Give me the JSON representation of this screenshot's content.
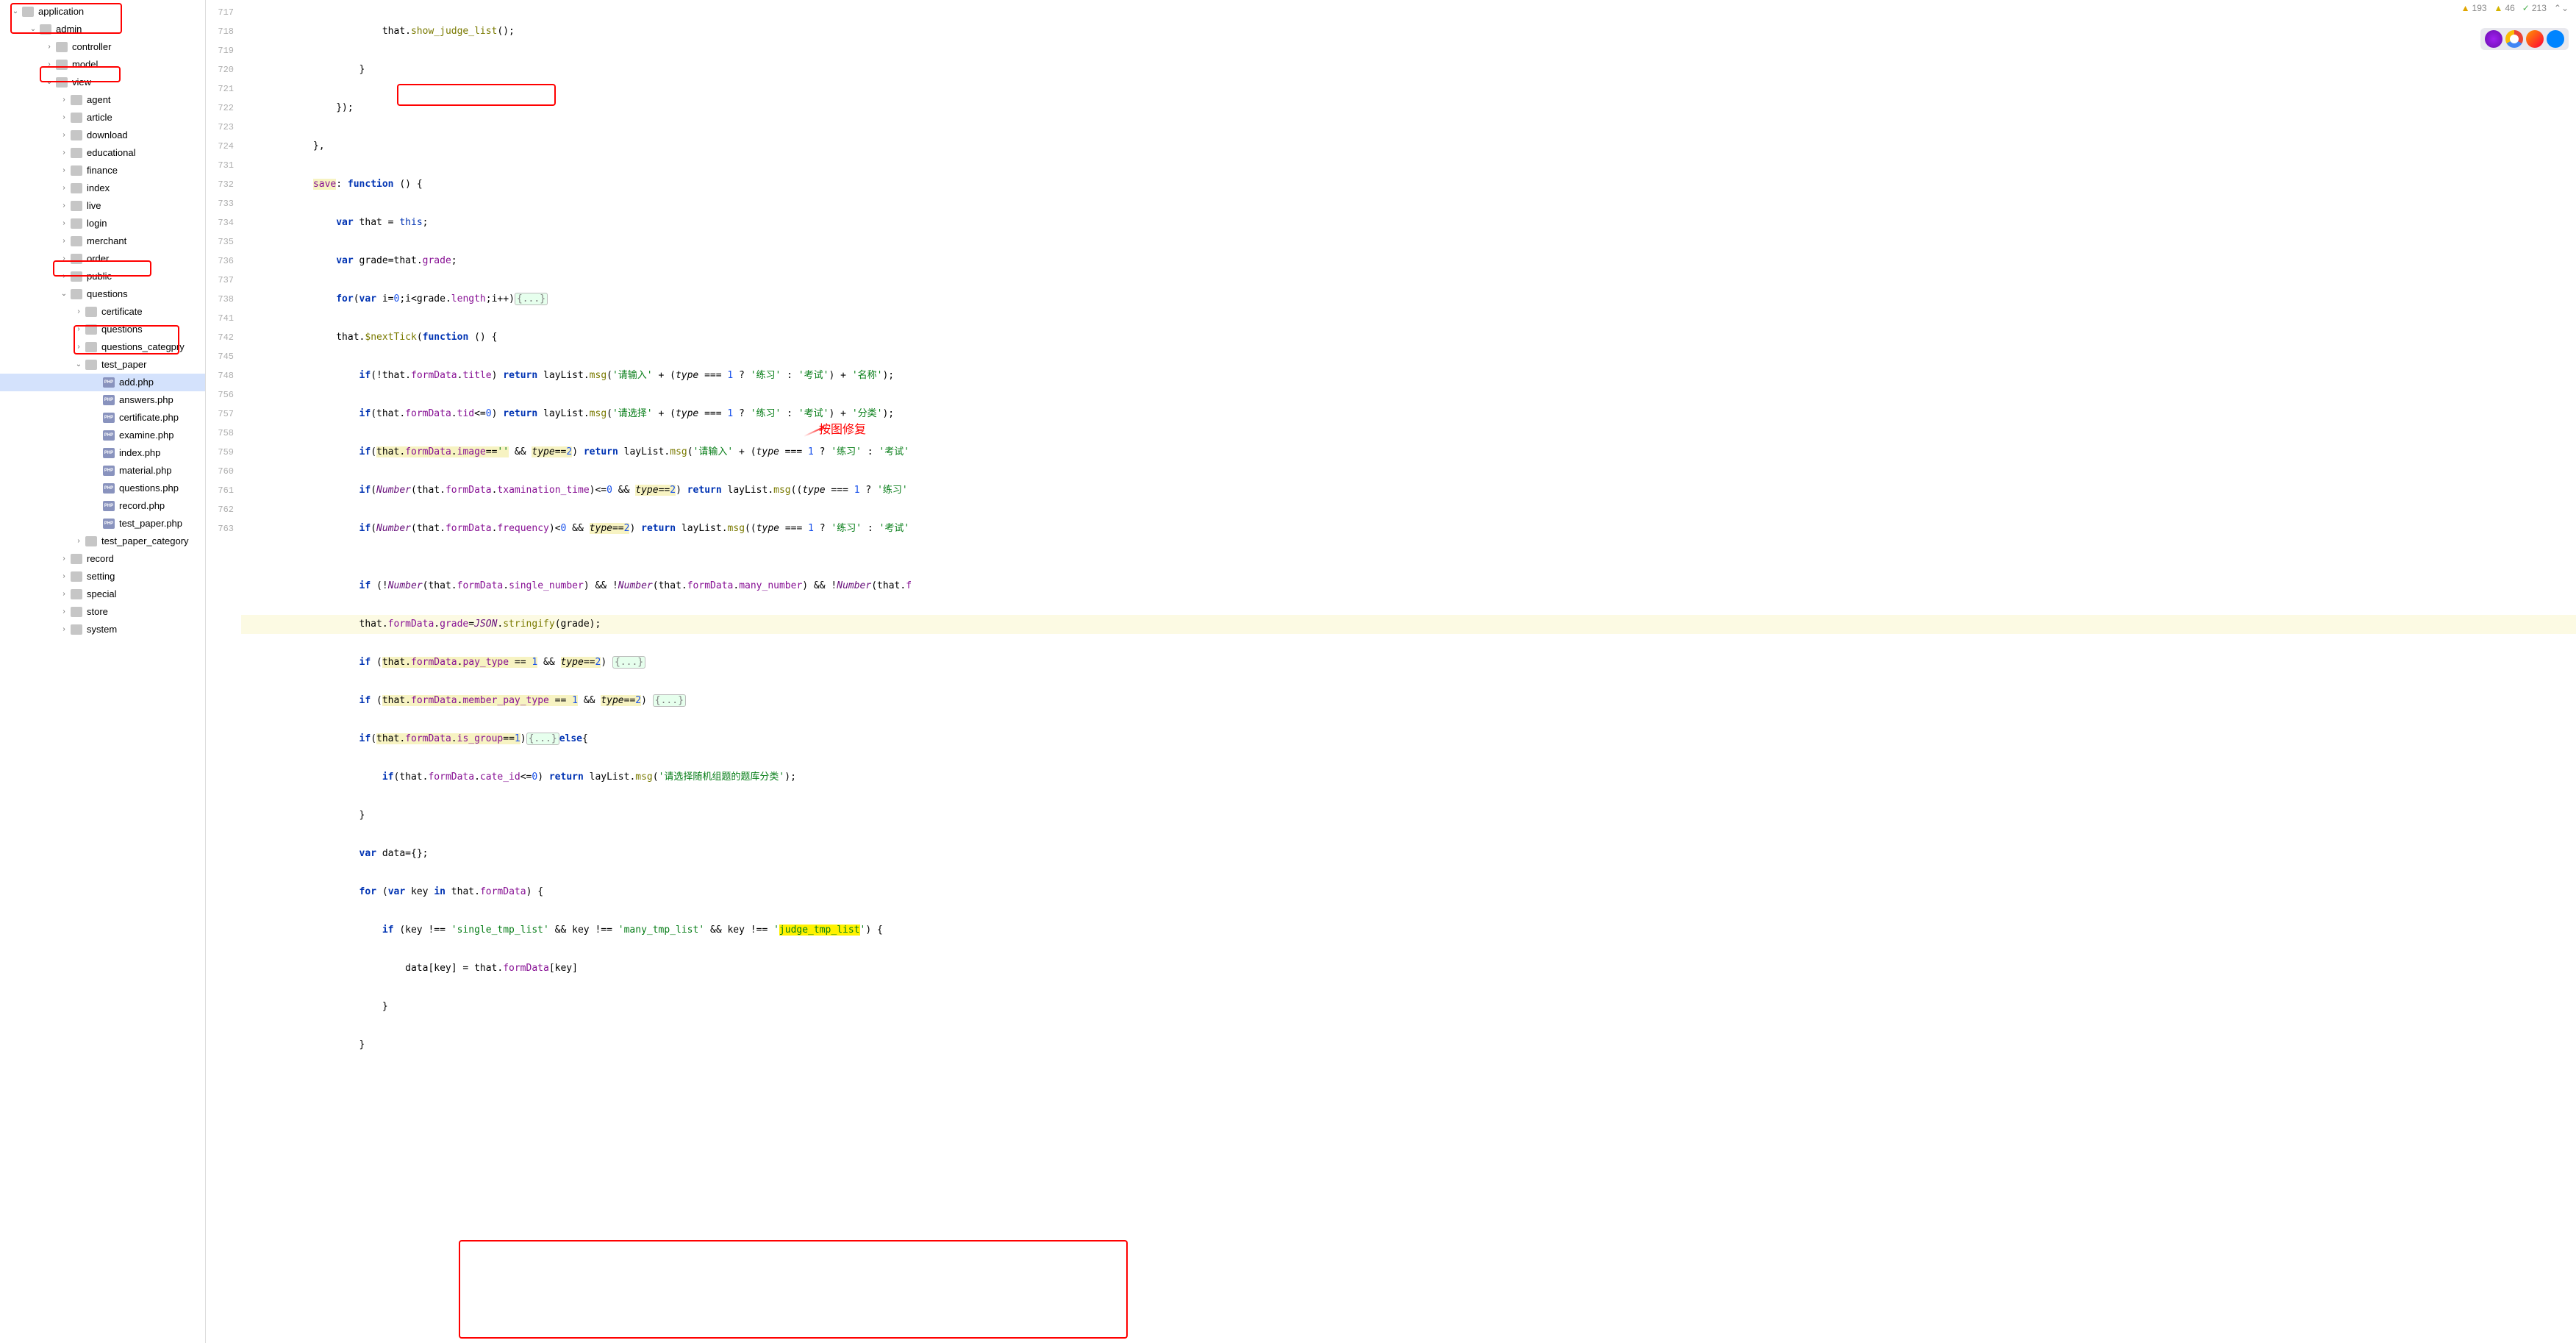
{
  "tree": {
    "application": "application",
    "admin": "admin",
    "controller": "controller",
    "model": "model",
    "view": "view",
    "agent": "agent",
    "article": "article",
    "download": "download",
    "educational": "educational",
    "finance": "finance",
    "index": "index",
    "live": "live",
    "login": "login",
    "merchant": "merchant",
    "order": "order",
    "public": "public",
    "questions": "questions",
    "certificate": "certificate",
    "questions2": "questions",
    "questions_category": "questions_categpry",
    "test_paper": "test_paper",
    "add_php": "add.php",
    "answers_php": "answers.php",
    "certificate_php": "certificate.php",
    "examine_php": "examine.php",
    "index_php": "index.php",
    "material_php": "material.php",
    "questions_php": "questions.php",
    "record_php": "record.php",
    "test_paper_php": "test_paper.php",
    "test_paper_category": "test_paper_category",
    "record": "record",
    "setting": "setting",
    "special": "special",
    "store": "store",
    "system": "system"
  },
  "status": {
    "warnings": "193",
    "weak_warnings": "46",
    "oks": "213"
  },
  "annotation": "按图修复",
  "chart_data": {
    "type": "table",
    "title": "Code editor lines",
    "lines": [
      {
        "num": 717,
        "text": "                        that.show_judge_list();"
      },
      {
        "num": 718,
        "text": "                    }"
      },
      {
        "num": 719,
        "text": "                });"
      },
      {
        "num": 720,
        "text": "            },"
      },
      {
        "num": 721,
        "text": "            save: function () {"
      },
      {
        "num": 722,
        "text": "                var that = this;"
      },
      {
        "num": 723,
        "text": "                var grade=that.grade;"
      },
      {
        "num": 724,
        "text": "                for(var i=0;i<grade.length;i++){...}"
      },
      {
        "num": 731,
        "text": "                that.$nextTick(function () {"
      },
      {
        "num": 732,
        "text": "                    if(!that.formData.title) return layList.msg('请输入' + (type === 1 ? '练习' : '考试') + '名称');"
      },
      {
        "num": 733,
        "text": "                    if(that.formData.tid<=0) return layList.msg('请选择' + (type === 1 ? '练习' : '考试') + '分类');"
      },
      {
        "num": 734,
        "text": "                    if(that.formData.image=='' && type==2) return layList.msg('请输入' + (type === 1 ? '练习' : '考试'"
      },
      {
        "num": 735,
        "text": "                    if(Number(that.formData.txamination_time)<=0 && type==2) return layList.msg((type === 1 ? '练习'"
      },
      {
        "num": 736,
        "text": "                    if(Number(that.formData.frequency)<0 && type==2) return layList.msg((type === 1 ? '练习' : '考试'"
      },
      {
        "num": 737,
        "text": ""
      },
      {
        "num": 738,
        "text": "                    if (!Number(that.formData.single_number) && !Number(that.formData.many_number) && !Number(that.f"
      },
      {
        "num": 741,
        "text": "                    that.formData.grade=JSON.stringify(grade);"
      },
      {
        "num": 742,
        "text": "                    if (that.formData.pay_type == 1 && type==2) {...}"
      },
      {
        "num": 745,
        "text": "                    if (that.formData.member_pay_type == 1 && type==2) {...}"
      },
      {
        "num": 748,
        "text": "                    if(that.formData.is_group==1){...}else{"
      },
      {
        "num": 756,
        "text": "                        if(that.formData.cate_id<=0) return layList.msg('请选择随机组题的题库分类');"
      },
      {
        "num": 757,
        "text": "                    }"
      },
      {
        "num": 758,
        "text": "                    var data={};"
      },
      {
        "num": 759,
        "text": "                    for (var key in that.formData) {"
      },
      {
        "num": 760,
        "text": "                        if (key !== 'single_tmp_list' && key !== 'many_tmp_list' && key !== 'judge_tmp_list') {"
      },
      {
        "num": 761,
        "text": "                            data[key] = that.formData[key]"
      },
      {
        "num": 762,
        "text": "                        }"
      },
      {
        "num": 763,
        "text": "                    }"
      }
    ]
  }
}
